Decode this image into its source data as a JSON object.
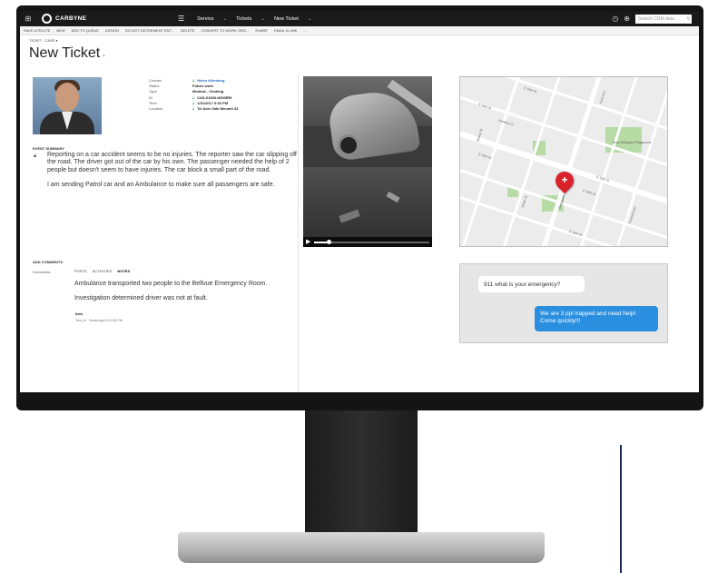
{
  "brand": {
    "name": "CARBYNE"
  },
  "nav": {
    "crumbs": [
      "Service",
      "Tickets",
      "New Ticket"
    ],
    "search_placeholder": "Search CRM data"
  },
  "commands": [
    "SAVE & ROUTE",
    "NEW",
    "ADD TO QUEUE",
    "ASSIGN",
    "DO NOT DECREMENT ENT...",
    "DELETE",
    "CONVERT TO WORK ORD...",
    "SHARE",
    "EMAIL A LINK",
    "..."
  ],
  "record": {
    "type_label": "TICKET : CASE ▾",
    "title": "New Ticket",
    "title_mark": "▪",
    "fields": [
      {
        "label": "Contact",
        "value": "Helen Allenberg",
        "is_link": true
      },
      {
        "label": "Status",
        "value": "Future work",
        "is_link": false
      },
      {
        "label": "Type",
        "value": "Medical - Choking",
        "is_link": false
      },
      {
        "label": "ID",
        "value": "CAS-01666-W3X5R9",
        "is_link": false
      },
      {
        "label": "Time",
        "value": "1/31/2017   9:02 PM",
        "is_link": false
      },
      {
        "label": "Location",
        "value": "Tel Aviv-Yafo Meumit 33",
        "is_link": false
      }
    ]
  },
  "event_summary": {
    "header": "EVENT SUMMARY",
    "paragraphs": [
      "Reporting on a car accident seems to be no injuries. The reporter saw the car slipping off the road. The driver got out of the car by his own. The passenger needed the help of 2 people but doesn't seem to have injuries. The car block a small part of the road.",
      "I am sending Patrol car and an Ambulance to make sure all passengers are safe."
    ]
  },
  "comments": {
    "header": "ADD COMMENTS",
    "label": "Comments",
    "tabs": [
      "POSTS",
      "ACTIVITIES",
      "NOTES"
    ],
    "active_tab": "NOTES",
    "notes": [
      "Ambulance transported two people to the Bellvue Emergency Room.",
      "Investigation determined driver was not at fault."
    ],
    "author": "Italo",
    "meta": "Terry ▾ · Yesterday 8:10:28 PM"
  },
  "video": {
    "progress": 0.12
  },
  "map": {
    "labels": [
      "E 16th St",
      "E 14th St",
      "Kent Ave",
      "Hawkey Ct",
      "E 15th St",
      "Walnut St",
      "E 13th St",
      "Arden St",
      "Bridgeway",
      "E 16th St",
      "E 19th St",
      "Tremont Ave",
      "Boyd Bellagam Playground"
    ]
  },
  "chat": {
    "incoming": "911 what is your emergency?",
    "outgoing": "We are 3 ppl trapped and need help! Come quickly!!!"
  }
}
